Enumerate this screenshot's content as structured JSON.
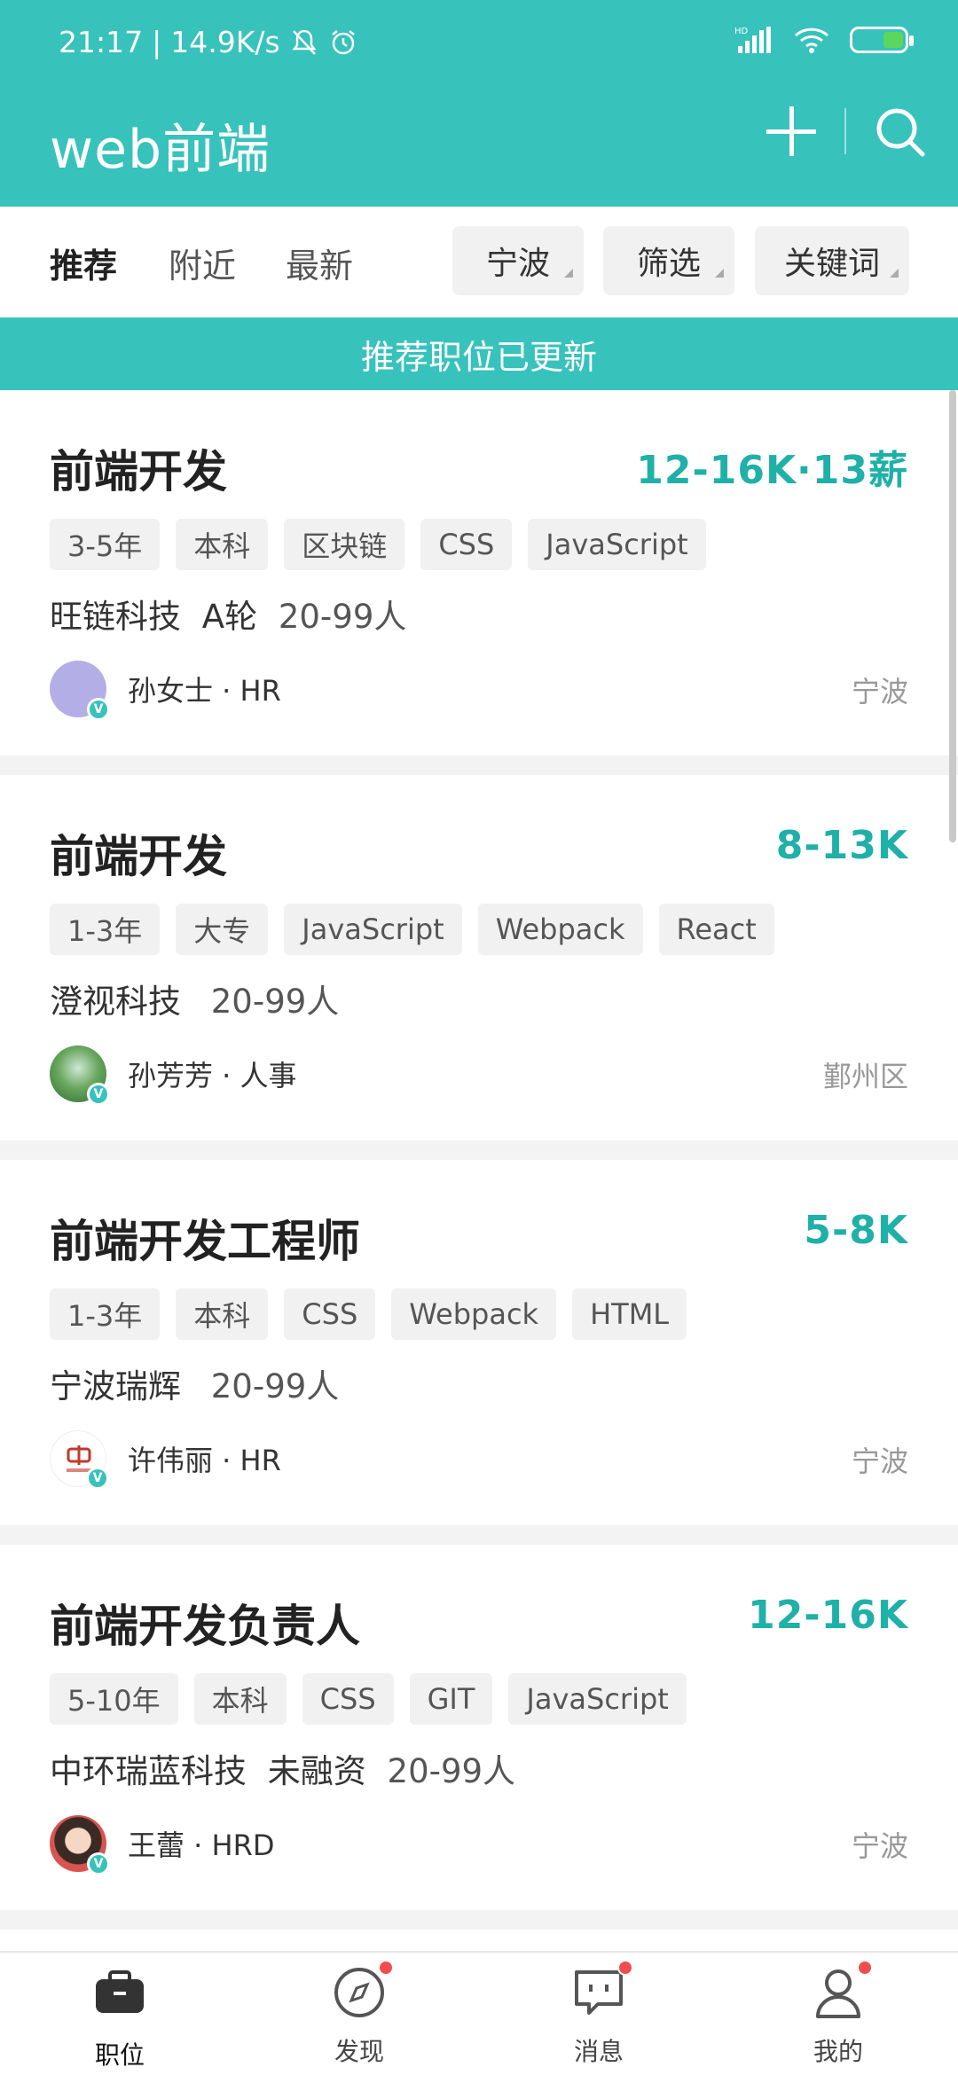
{
  "status": {
    "time": "21:17",
    "speed": "14.9K/s",
    "network": "HD"
  },
  "header": {
    "title": "web前端"
  },
  "filters": {
    "tabs": [
      "推荐",
      "附近",
      "最新"
    ],
    "chips": [
      "宁波",
      "筛选",
      "关键词"
    ]
  },
  "banner": "推荐职位已更新",
  "jobs": [
    {
      "title": "前端开发",
      "salary": "12-16K·13薪",
      "tags": [
        "3-5年",
        "本科",
        "区块链",
        "CSS",
        "JavaScript"
      ],
      "company": "旺链科技",
      "stage": "A轮",
      "size": "20-99人",
      "recruiter": "孙女士 · HR",
      "location": "宁波"
    },
    {
      "title": "前端开发",
      "salary": "8-13K",
      "tags": [
        "1-3年",
        "大专",
        "JavaScript",
        "Webpack",
        "React"
      ],
      "company": "澄视科技",
      "stage": "",
      "size": "20-99人",
      "recruiter": "孙芳芳 · 人事",
      "location": "鄞州区"
    },
    {
      "title": "前端开发工程师",
      "salary": "5-8K",
      "tags": [
        "1-3年",
        "本科",
        "CSS",
        "Webpack",
        "HTML"
      ],
      "company": "宁波瑞辉",
      "stage": "",
      "size": "20-99人",
      "recruiter": "许伟丽 · HR",
      "location": "宁波"
    },
    {
      "title": "前端开发负责人",
      "salary": "12-16K",
      "tags": [
        "5-10年",
        "本科",
        "CSS",
        "GIT",
        "JavaScript"
      ],
      "company": "中环瑞蓝科技",
      "stage": "未融资",
      "size": "20-99人",
      "recruiter": "王蕾 · HRD",
      "location": "宁波"
    }
  ],
  "nav": {
    "items": [
      "职位",
      "发现",
      "消息",
      "我的"
    ]
  },
  "colors": {
    "accent": "#37c2bc",
    "salary": "#1fb0a8",
    "badge": "#f04e4e"
  }
}
